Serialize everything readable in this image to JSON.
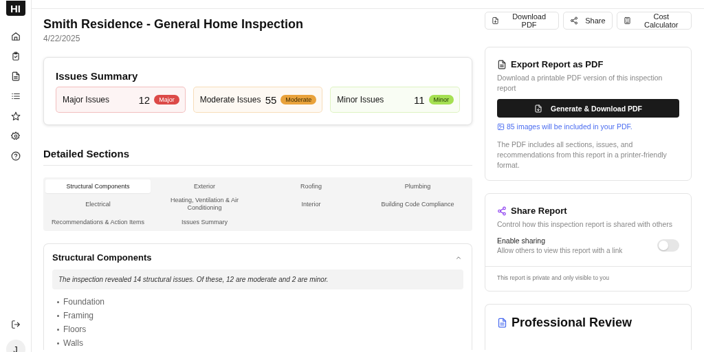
{
  "sidebar": {
    "logo": "HI",
    "avatar": "J"
  },
  "header": {
    "title": "Smith Residence - General Home Inspection",
    "date": "4/22/2025",
    "actions": [
      {
        "label": "Download PDF",
        "kind": "download"
      },
      {
        "label": "Share",
        "kind": "share"
      },
      {
        "label": "Cost Calculator",
        "kind": "calculator"
      }
    ]
  },
  "issues_summary": {
    "title": "Issues Summary",
    "items": [
      {
        "label": "Major Issues",
        "count": "12",
        "badge": "Major",
        "kind": "major",
        "color": "#dc4a48"
      },
      {
        "label": "Moderate Issues",
        "count": "55",
        "badge": "Moderate",
        "kind": "moderate",
        "color": "#e9a23b"
      },
      {
        "label": "Minor Issues",
        "count": "11",
        "badge": "Minor",
        "kind": "minor",
        "color": "#a5e052"
      }
    ]
  },
  "detailed_sections": {
    "title": "Detailed Sections",
    "tabs": [
      {
        "label": "Structural Components",
        "selected": true
      },
      {
        "label": "Exterior",
        "selected": false
      },
      {
        "label": "Roofing",
        "selected": false
      },
      {
        "label": "Plumbing",
        "selected": false
      },
      {
        "label": "Electrical",
        "selected": false
      },
      {
        "label": "Heating, Ventilation & Air Conditioning",
        "selected": false
      },
      {
        "label": "Interior",
        "selected": false
      },
      {
        "label": "Building Code Compliance",
        "selected": false
      },
      {
        "label": "Recommendations & Action Items",
        "selected": false
      },
      {
        "label": "Issues Summary",
        "selected": false
      }
    ]
  },
  "section": {
    "title": "Structural Components",
    "expanded": true,
    "summary": "The inspection revealed 14 structural issues. Of these, 12 are moderate and 2 are minor.",
    "items": [
      "Foundation",
      "Framing",
      "Floors",
      "Walls"
    ]
  },
  "export_card": {
    "title": "Export Report as PDF",
    "description": "Download a printable PDF version of this inspection report",
    "button": "Generate & Download PDF",
    "images_note": "85 images will be included in your PDF.",
    "footnote": "The PDF includes all sections, issues, and recommendations from this report in a printer-friendly format."
  },
  "share_card": {
    "title": "Share Report",
    "description": "Control how this inspection report is shared with others",
    "toggle_label": "Enable sharing",
    "toggle_hint": "Allow others to view this report with a link",
    "on": false,
    "footer": "This report is private and only visible to you"
  },
  "review_card": {
    "title": "Professional Review"
  }
}
